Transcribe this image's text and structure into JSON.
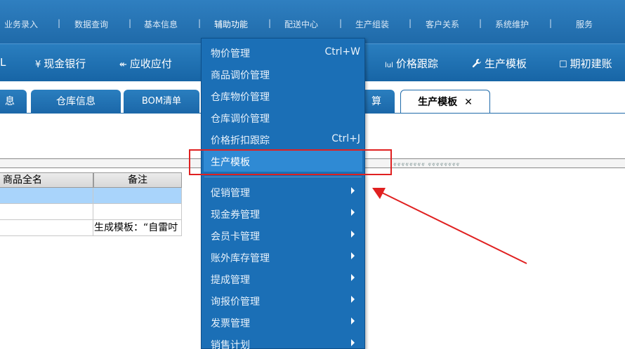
{
  "top_menu": {
    "items": [
      "业务录入",
      "数据查询",
      "基本信息",
      "辅助功能",
      "配送中心",
      "生产组装",
      "客户关系",
      "系统维护",
      "服务"
    ],
    "separator": "|"
  },
  "toolbar": {
    "items": [
      {
        "icon": "",
        "label": "L"
      },
      {
        "icon": "¥",
        "label": "现金银行"
      },
      {
        "icon": "↞",
        "label": "应收应付"
      },
      {
        "icon": "lul",
        "label": "价格跟踪"
      },
      {
        "icon": "wrench",
        "label": "生产模板"
      },
      {
        "icon": "☐",
        "label": "期初建账"
      }
    ]
  },
  "tabs": [
    {
      "label": "息"
    },
    {
      "label": "仓库信息"
    },
    {
      "label": "BOM清单"
    },
    {
      "label": "算"
    },
    {
      "label": "生产模板",
      "close": "✕"
    }
  ],
  "splitter": {
    "grip": "ⱴⱴⱴⱴⱴⱴⱴⱴ  ⱴⱴⱴⱴⱴⱴⱴⱴ"
  },
  "grid": {
    "headers": [
      "商品全名",
      "备注"
    ],
    "rows": [
      [
        "",
        ""
      ],
      [
        "",
        ""
      ],
      [
        "",
        "生成模板：“自雷吋"
      ]
    ]
  },
  "dropdown": {
    "items": [
      {
        "label": "物价管理",
        "shortcut": "Ctrl+W"
      },
      {
        "label": "商品调价管理",
        "shortcut": ""
      },
      {
        "label": "仓库物价管理",
        "shortcut": ""
      },
      {
        "label": "仓库调价管理",
        "shortcut": ""
      },
      {
        "label": "价格折扣跟踪",
        "shortcut": "Ctrl+J"
      },
      {
        "label": "生产模板",
        "shortcut": ""
      },
      {
        "label": "促销管理",
        "shortcut": ""
      },
      {
        "label": "现金券管理",
        "shortcut": ""
      },
      {
        "label": "会员卡管理",
        "shortcut": ""
      },
      {
        "label": "账外库存管理",
        "shortcut": ""
      },
      {
        "label": "提成管理",
        "shortcut": ""
      },
      {
        "label": "询报价管理",
        "shortcut": ""
      },
      {
        "label": "发票管理",
        "shortcut": ""
      },
      {
        "label": "销售计划",
        "shortcut": ""
      }
    ]
  },
  "colors": {
    "menubar": "#1f6aa9",
    "dropdown": "#1b6fb6",
    "highlight": "#2f8ad4",
    "annotation": "#e02020",
    "selected_row": "#a9d4fb"
  }
}
